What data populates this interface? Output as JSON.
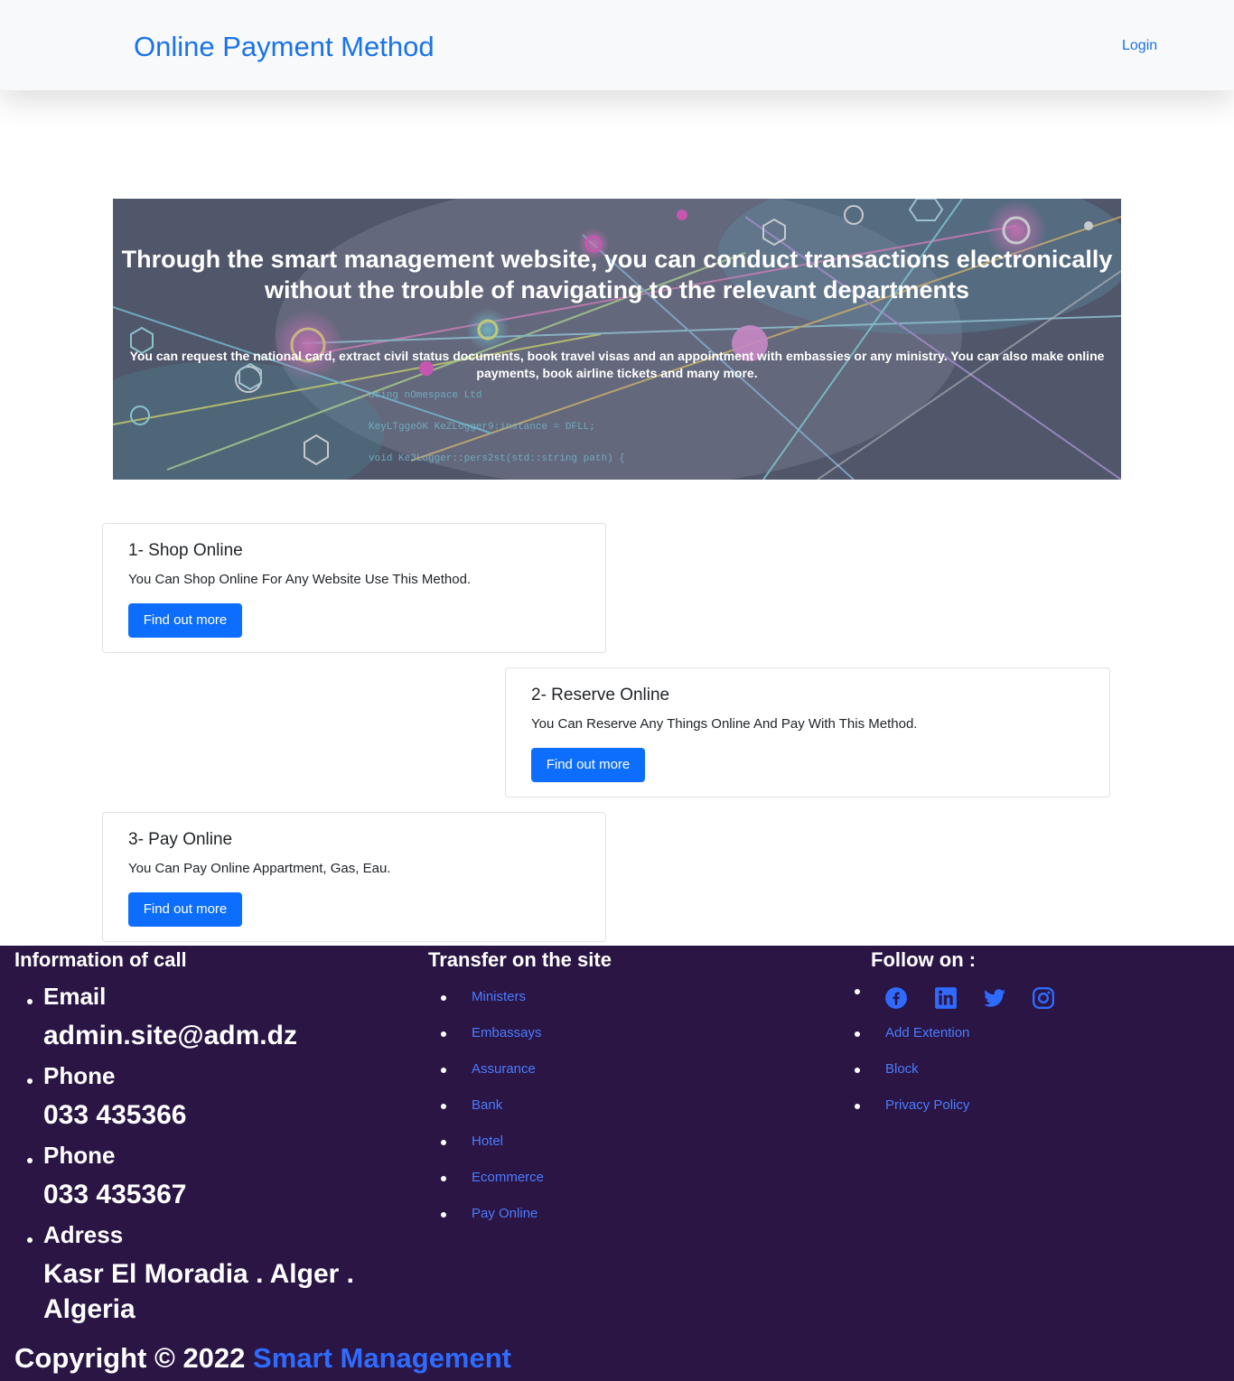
{
  "nav": {
    "brand": "Online Payment Method",
    "login": "Login"
  },
  "hero": {
    "title": "Through the smart management website, you can conduct transactions electronically without the trouble of navigating to the relevant departments",
    "subtitle": "You can request the national card, extract civil status documents, book travel visas and an appointment with embassies or any ministry. You can also make online payments, book airline tickets and many more.",
    "code_lines": [
      "using nOmespace Ltd",
      "KeyLTggeOK KeZLogger9:instance = DFLL;",
      "void Ke3Logger::pers2st(std::string path) {"
    ]
  },
  "cards": [
    {
      "title": "1- Shop Online",
      "text": "You Can Shop Online For Any Website Use This Method.",
      "button": "Find out more"
    },
    {
      "title": "2- Reserve Online",
      "text": "You Can Reserve Any Things Online And Pay With This Method.",
      "button": "Find out more"
    },
    {
      "title": "3- Pay Online",
      "text": "You Can Pay Online Appartment, Gas, Eau.",
      "button": "Find out more"
    }
  ],
  "footer": {
    "info_heading": "Information of call",
    "info": [
      {
        "label": "Email",
        "value": "admin.site@adm.dz"
      },
      {
        "label": "Phone",
        "value": "033 435366"
      },
      {
        "label": "Phone",
        "value": "033 435367"
      },
      {
        "label": "Adress",
        "value": "Kasr El Moradia . Alger . Algeria"
      }
    ],
    "transfer_heading": "Transfer on the site",
    "transfer_links": [
      "Ministers",
      "Embassays",
      "Assurance",
      "Bank",
      "Hotel",
      "Ecommerce",
      "Pay Online"
    ],
    "follow_heading": "Follow on :",
    "social_icons": [
      "facebook-icon",
      "linkedin-icon",
      "twitter-icon",
      "instagram-icon"
    ],
    "follow_links": [
      "Add Extention",
      "Block",
      "Privacy Policy"
    ],
    "copyright_prefix": "Copyright © 2022",
    "copyright_brand": "Smart Management"
  },
  "colors": {
    "brand": "#1a73e8",
    "button": "#0d6efd",
    "footer_bg": "#2a1544",
    "footer_link": "#4a7cff"
  }
}
